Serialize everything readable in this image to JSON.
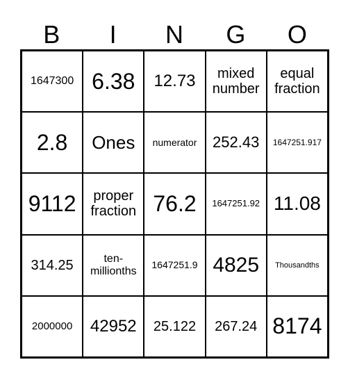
{
  "header": [
    "B",
    "I",
    "N",
    "G",
    "O"
  ],
  "cells": [
    [
      "1647300",
      "6.38",
      "12.73",
      "mixed\nnumber",
      "equal\nfraction"
    ],
    [
      "2.8",
      "Ones",
      "numerator",
      "252.43",
      "1647251.917"
    ],
    [
      "9112",
      "proper\nfraction",
      "76.2",
      "1647251.92",
      "11.08"
    ],
    [
      "314.25",
      "ten-\nmillionths",
      "1647251.9",
      "4825",
      "Thousandths"
    ],
    [
      "2000000",
      "42952",
      "25.122",
      "267.24",
      "8174"
    ]
  ]
}
